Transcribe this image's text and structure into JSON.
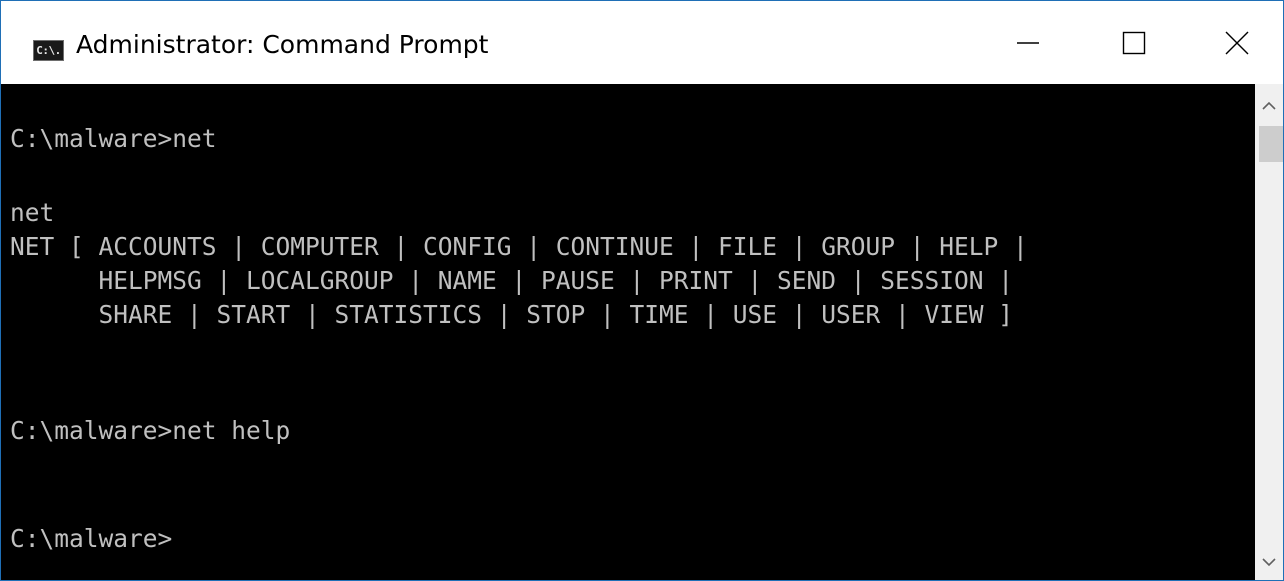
{
  "window": {
    "title": "Administrator: Command Prompt",
    "app_icon_text": "C:\\."
  },
  "controls": {
    "minimize": "minimize-icon",
    "maximize": "maximize-icon",
    "close": "close-icon"
  },
  "console": {
    "lines": [
      "C:\\malware>net",
      "net",
      "NET [ ACCOUNTS | COMPUTER | CONFIG | CONTINUE | FILE | GROUP | HELP |",
      "      HELPMSG | LOCALGROUP | NAME | PAUSE | PRINT | SEND | SESSION |",
      "      SHARE | START | STATISTICS | STOP | TIME | USE | USER | VIEW ]",
      "C:\\malware>net help",
      "C:\\malware>"
    ]
  },
  "colors": {
    "titlebar_bg": "#ffffff",
    "window_border": "#1f6fb6",
    "console_bg": "#000000",
    "console_text": "#c0c0c0",
    "scrollbar_track": "#f0f0f0",
    "scrollbar_thumb": "#cdcdcd"
  }
}
